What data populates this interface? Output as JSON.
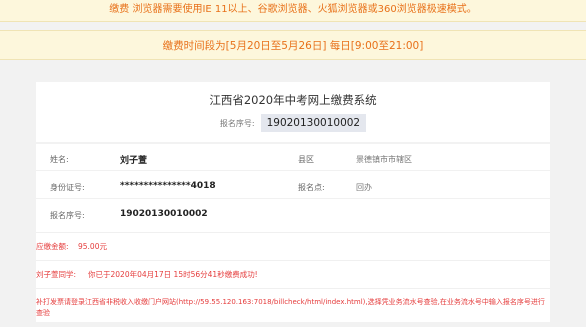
{
  "notices": {
    "browser": "缴费 浏览器需要使用IE 11以上、谷歌浏览器、火狐浏览器或360浏览器极速模式。",
    "time": "缴费时间段为[5月20日至5月26日] 每日[9:00至21:00]"
  },
  "system": {
    "title": "江西省2020年中考网上缴费系统",
    "reg_label": "报名序号:",
    "reg_value": "19020130010002"
  },
  "student": {
    "name_label": "姓名:",
    "name_value": "刘子萱",
    "district_label": "县区",
    "district_value": "景德镇市市辖区",
    "id_label": "身份证号:",
    "id_value": "***************4018",
    "site_label": "报名点:",
    "site_value": "回办",
    "reg_label": "报名序号:",
    "reg_value": "19020130010002"
  },
  "payment": {
    "fee_label": "应缴金额:",
    "fee_value": "95.00元",
    "status_name": "刘子萱同学:",
    "status_message": "你已于2020年04月17日 15时56分41秒缴费成功!",
    "note": "补打发票请登录江西省非税收入收缴门户网站(http://59.55.120.163:7018/billcheck/html/index.html),选择凭业务流水号查验,在业务流水号中输入报名序号进行查验"
  }
}
